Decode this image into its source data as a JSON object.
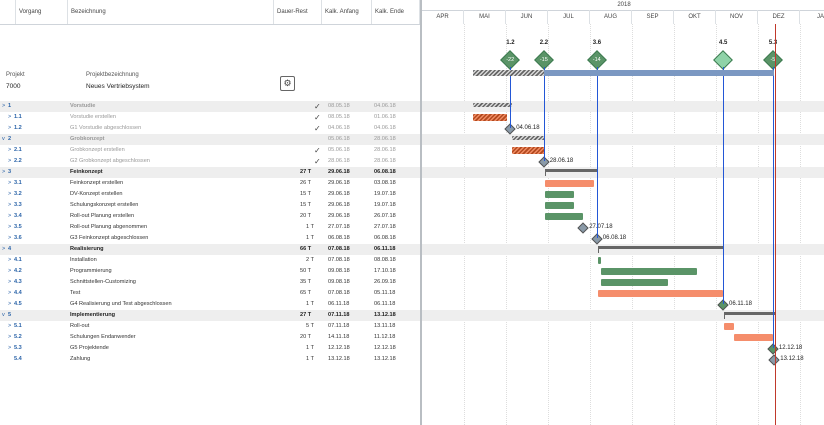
{
  "columns": {
    "vorgang": "Vorgang",
    "bezeichnung": "Bezeichnung",
    "dauer": "Dauer-Rest",
    "anfang": "Kalk. Anfang",
    "ende": "Kalk. Ende"
  },
  "project": {
    "label_proj": "Projekt",
    "label_bez": "Projektbezeichnung",
    "number": "7000",
    "name": "Neues Vertriebsystem",
    "gear_icon": "gear-icon"
  },
  "timeline": {
    "year": "2018",
    "months": [
      "APR",
      "MAI",
      "JUN",
      "JUL",
      "AUG",
      "SEP",
      "OKT",
      "NOV",
      "DEZ",
      "JA"
    ]
  },
  "milestone_header": [
    {
      "id": "1.2",
      "value": "-22",
      "color": "#5a9467"
    },
    {
      "id": "2.2",
      "value": "-15",
      "color": "#5a9467"
    },
    {
      "id": "3.6",
      "value": "-14",
      "color": "#5a9467"
    },
    {
      "id": "4.5",
      "value": "",
      "color": "#8fd3a8"
    },
    {
      "id": "5.3",
      "value": "-5",
      "color": "#5a9467"
    }
  ],
  "rows": [
    {
      "id": "1",
      "name": "Vorstudie",
      "dur": "",
      "start": "08.05.18",
      "end": "04.06.18",
      "done": true,
      "level": 0,
      "summary": true,
      "expand": ">"
    },
    {
      "id": "1.1",
      "name": "Vorstudie erstellen",
      "dur": "",
      "start": "08.05.18",
      "end": "01.06.18",
      "done": true,
      "level": 1,
      "summary": false,
      "expand": ">"
    },
    {
      "id": "1.2",
      "name": "G1 Vorstudie abgeschlossen",
      "dur": "",
      "start": "04.06.18",
      "end": "04.06.18",
      "done": true,
      "level": 1,
      "summary": false,
      "expand": ">"
    },
    {
      "id": "2",
      "name": "Grobkonzept",
      "dur": "",
      "start": "05.06.18",
      "end": "28.06.18",
      "done": false,
      "level": 0,
      "summary": true,
      "expand": "v"
    },
    {
      "id": "2.1",
      "name": "Grobkonzept erstellen",
      "dur": "",
      "start": "05.06.18",
      "end": "28.06.18",
      "done": true,
      "level": 1,
      "summary": false,
      "expand": ">"
    },
    {
      "id": "2.2",
      "name": "G2 Grobkonzept abgeschlossen",
      "dur": "",
      "start": "28.06.18",
      "end": "28.06.18",
      "done": true,
      "level": 1,
      "summary": false,
      "expand": ">"
    },
    {
      "id": "3",
      "name": "Feinkonzept",
      "dur": "27 T",
      "start": "29.06.18",
      "end": "06.08.18",
      "done": false,
      "level": 0,
      "summary": true,
      "expand": ">"
    },
    {
      "id": "3.1",
      "name": "Feinkonzept erstellen",
      "dur": "26 T",
      "start": "29.06.18",
      "end": "03.08.18",
      "done": false,
      "level": 1,
      "summary": false,
      "expand": ">"
    },
    {
      "id": "3.2",
      "name": "DV-Konzept erstellen",
      "dur": "15 T",
      "start": "29.06.18",
      "end": "19.07.18",
      "done": false,
      "level": 1,
      "summary": false,
      "expand": ">"
    },
    {
      "id": "3.3",
      "name": "Schulungskonzept erstellen",
      "dur": "15 T",
      "start": "29.06.18",
      "end": "19.07.18",
      "done": false,
      "level": 1,
      "summary": false,
      "expand": ">"
    },
    {
      "id": "3.4",
      "name": "Roll-out Planung erstellen",
      "dur": "20 T",
      "start": "29.06.18",
      "end": "26.07.18",
      "done": false,
      "level": 1,
      "summary": false,
      "expand": ">"
    },
    {
      "id": "3.5",
      "name": "Roll-out Planung abgenommen",
      "dur": "1 T",
      "start": "27.07.18",
      "end": "27.07.18",
      "done": false,
      "level": 1,
      "summary": false,
      "expand": ">"
    },
    {
      "id": "3.6",
      "name": "G3 Feinkonzept abgeschlossen",
      "dur": "1 T",
      "start": "06.08.18",
      "end": "06.08.18",
      "done": false,
      "level": 1,
      "summary": false,
      "expand": ">"
    },
    {
      "id": "4",
      "name": "Realisierung",
      "dur": "66 T",
      "start": "07.08.18",
      "end": "06.11.18",
      "done": false,
      "level": 0,
      "summary": true,
      "expand": ">"
    },
    {
      "id": "4.1",
      "name": "Installation",
      "dur": "2 T",
      "start": "07.08.18",
      "end": "08.08.18",
      "done": false,
      "level": 1,
      "summary": false,
      "expand": ">"
    },
    {
      "id": "4.2",
      "name": "Programmierung",
      "dur": "50 T",
      "start": "09.08.18",
      "end": "17.10.18",
      "done": false,
      "level": 1,
      "summary": false,
      "expand": ">"
    },
    {
      "id": "4.3",
      "name": "Schnittstellen-Customizing",
      "dur": "35 T",
      "start": "09.08.18",
      "end": "26.09.18",
      "done": false,
      "level": 1,
      "summary": false,
      "expand": ">"
    },
    {
      "id": "4.4",
      "name": "Test",
      "dur": "65 T",
      "start": "07.08.18",
      "end": "05.11.18",
      "done": false,
      "level": 1,
      "summary": false,
      "expand": ">"
    },
    {
      "id": "4.5",
      "name": "G4 Realisierung und Test abgeschlossen",
      "dur": "1 T",
      "start": "06.11.18",
      "end": "06.11.18",
      "done": false,
      "level": 1,
      "summary": false,
      "expand": ">"
    },
    {
      "id": "5",
      "name": "Implementierung",
      "dur": "27 T",
      "start": "07.11.18",
      "end": "13.12.18",
      "done": false,
      "level": 0,
      "summary": true,
      "expand": "v"
    },
    {
      "id": "5.1",
      "name": "Roll-out",
      "dur": "5 T",
      "start": "07.11.18",
      "end": "13.11.18",
      "done": false,
      "level": 1,
      "summary": false,
      "expand": ">"
    },
    {
      "id": "5.2",
      "name": "Schulungen Endanwender",
      "dur": "20 T",
      "start": "14.11.18",
      "end": "11.12.18",
      "done": false,
      "level": 1,
      "summary": false,
      "expand": ">"
    },
    {
      "id": "5.3",
      "name": "G5 Projektende",
      "dur": "1 T",
      "start": "12.12.18",
      "end": "12.12.18",
      "done": false,
      "level": 1,
      "summary": false,
      "expand": ">"
    },
    {
      "id": "5.4",
      "name": "Zahlung",
      "dur": "1 T",
      "start": "13.12.18",
      "end": "13.12.18",
      "done": false,
      "level": 1,
      "summary": false,
      "expand": ""
    }
  ],
  "milestone_labels": {
    "m12": "04.06.18",
    "m22": "28.06.18",
    "m35": "27.07.18",
    "m36": "06.08.18",
    "m45": "06.11.18",
    "m53": "12.12.18",
    "m54": "13.12.18"
  }
}
